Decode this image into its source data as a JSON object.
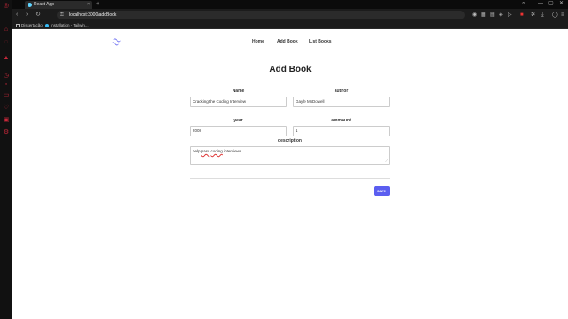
{
  "browser": {
    "tab_title": "React App",
    "tab_close": "×",
    "new_tab": "+",
    "url": "localhost:3000/addBook",
    "bookmarks": [
      "Dissertação",
      "Installation - Tailwin..."
    ]
  },
  "site": {
    "nav": {
      "home": "Home",
      "add_book": "Add Book",
      "list_books": "List Books"
    },
    "title": "Add Book"
  },
  "form": {
    "name": {
      "label": "Name",
      "value": "Cracking the Coding Interview"
    },
    "author": {
      "label": "author",
      "value": "Gayle McDowell"
    },
    "year": {
      "label": "year",
      "value": "2008"
    },
    "ammount": {
      "label": "ammount",
      "value": "1"
    },
    "description": {
      "label": "description",
      "value_parts": [
        "help ",
        "pass",
        " ",
        "coding",
        " interviews"
      ]
    },
    "save_label": "save"
  },
  "colors": {
    "accent": "#5b5ef0",
    "sidebar_icons": "#c8283a"
  }
}
